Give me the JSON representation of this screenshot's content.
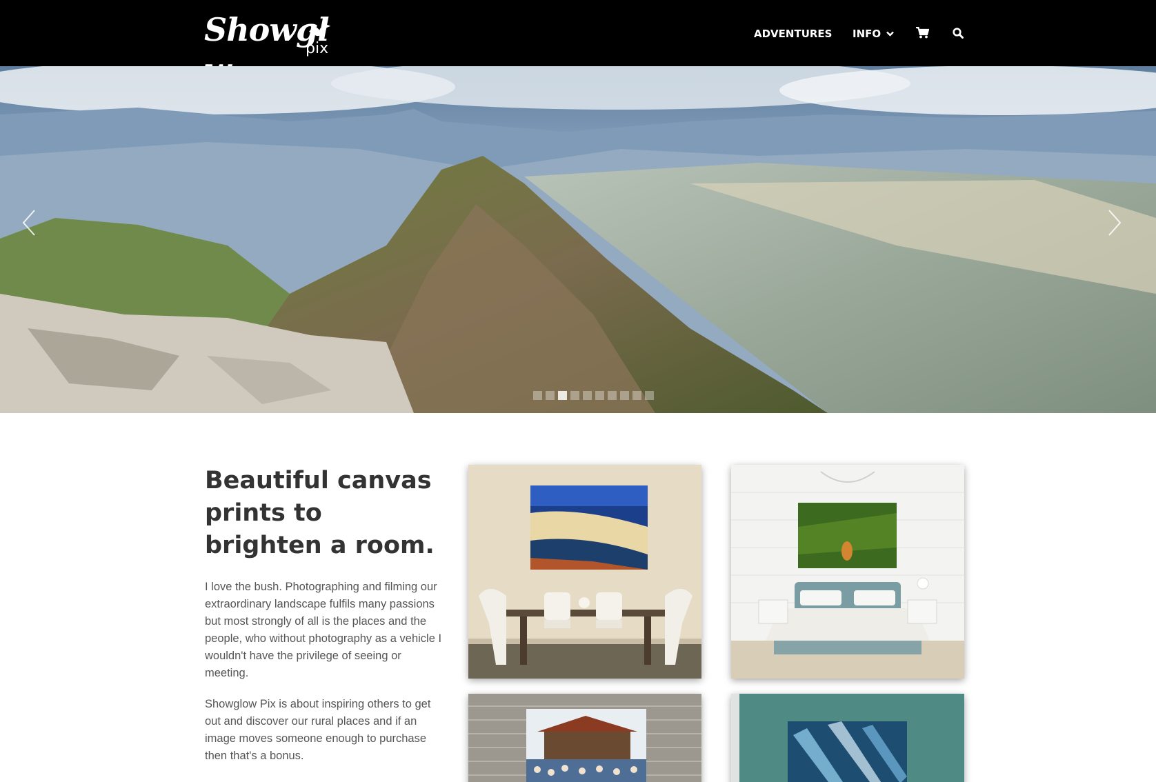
{
  "header": {
    "logo_main": "Showgl w",
    "logo_sub": "pix",
    "nav": {
      "adventures": "ADVENTURES",
      "info": "INFO"
    },
    "icons": [
      "chevron-down-icon",
      "cart-icon",
      "search-icon"
    ]
  },
  "hero": {
    "slide_count": 10,
    "active_slide": 3
  },
  "content": {
    "headline": "Beautiful canvas prints to brighten a room.",
    "paragraph_1": "I love the bush. Photographing and filming our extraordinary landscape fulfils many passions but most strongly of all is the places and the people, who without photography as a vehicle I wouldn't have the privilege of seeing or meeting.",
    "paragraph_2": "Showglow Pix is about inspiring others to get out and discover our rural places and if an image moves someone enough to purchase then that's a bonus."
  },
  "colors": {
    "header_bg": "#000000",
    "text_dark": "#333333",
    "text_body": "#555555"
  }
}
